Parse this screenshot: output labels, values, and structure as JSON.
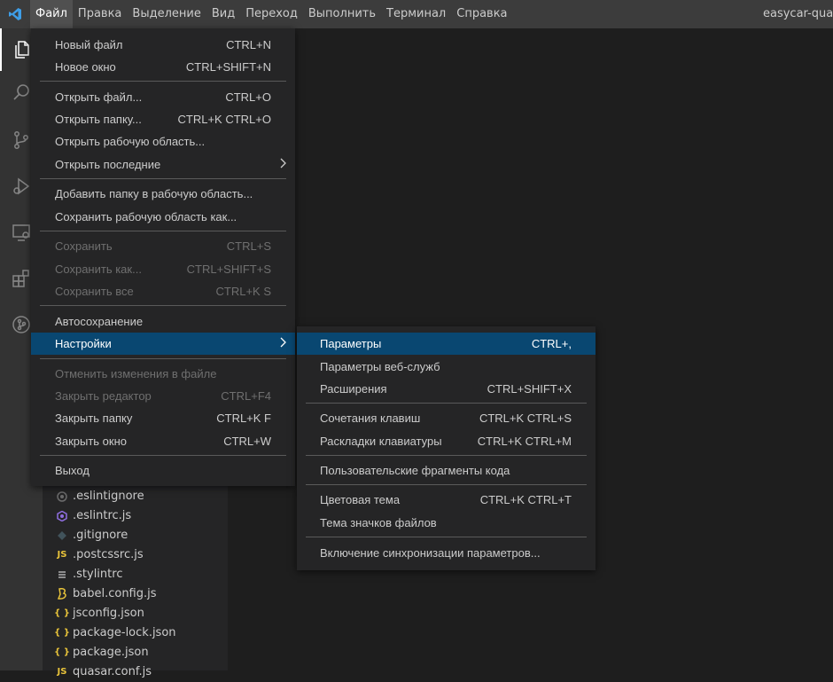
{
  "menubar": {
    "items": [
      "Файл",
      "Правка",
      "Выделение",
      "Вид",
      "Переход",
      "Выполнить",
      "Терминал",
      "Справка"
    ],
    "window_title": "easycar-quasar"
  },
  "colors": {
    "menu_bg": "#252526",
    "selection": "#094771",
    "titlebar": "#3c3c3c",
    "activitybar": "#333333",
    "sidebar": "#252526",
    "editor": "#1e1e1e"
  },
  "activity_icons": [
    "explorer-icon",
    "search-icon",
    "source-control-icon",
    "run-debug-icon",
    "remote-explorer-icon",
    "extensions-icon",
    "git-graph-icon"
  ],
  "file_menu": {
    "items": [
      {
        "label": "Новый файл",
        "shortcut": "CTRL+N"
      },
      {
        "label": "Новое окно",
        "shortcut": "CTRL+SHIFT+N"
      },
      {
        "label": "Открыть файл...",
        "shortcut": "CTRL+O"
      },
      {
        "label": "Открыть папку...",
        "shortcut": "CTRL+K CTRL+O"
      },
      {
        "label": "Открыть рабочую область...",
        "shortcut": ""
      },
      {
        "label": "Открыть последние",
        "shortcut": "",
        "submenu": true
      },
      {
        "label": "Добавить папку в рабочую область...",
        "shortcut": ""
      },
      {
        "label": "Сохранить рабочую область как...",
        "shortcut": ""
      },
      {
        "label": "Сохранить",
        "shortcut": "CTRL+S",
        "disabled": true
      },
      {
        "label": "Сохранить как...",
        "shortcut": "CTRL+SHIFT+S",
        "disabled": true
      },
      {
        "label": "Сохранить все",
        "shortcut": "CTRL+K S",
        "disabled": true
      },
      {
        "label": "Автосохранение",
        "shortcut": ""
      },
      {
        "label": "Настройки",
        "shortcut": "",
        "submenu": true,
        "selected": true
      },
      {
        "label": "Отменить изменения в файле",
        "shortcut": "",
        "disabled": true
      },
      {
        "label": "Закрыть редактор",
        "shortcut": "CTRL+F4",
        "disabled": true
      },
      {
        "label": "Закрыть папку",
        "shortcut": "CTRL+K F"
      },
      {
        "label": "Закрыть окно",
        "shortcut": "CTRL+W"
      },
      {
        "label": "Выход",
        "shortcut": ""
      }
    ]
  },
  "prefs_menu": {
    "items": [
      {
        "label": "Параметры",
        "shortcut": "CTRL+,",
        "selected": true
      },
      {
        "label": "Параметры веб-служб",
        "shortcut": ""
      },
      {
        "label": "Расширения",
        "shortcut": "CTRL+SHIFT+X"
      },
      {
        "label": "Сочетания клавиш",
        "shortcut": "CTRL+K CTRL+S"
      },
      {
        "label": "Раскладки клавиатуры",
        "shortcut": "CTRL+K CTRL+M"
      },
      {
        "label": "Пользовательские фрагменты кода",
        "shortcut": ""
      },
      {
        "label": "Цветовая тема",
        "shortcut": "CTRL+K CTRL+T"
      },
      {
        "label": "Тема значков файлов",
        "shortcut": ""
      },
      {
        "label": "Включение синхронизации параметров...",
        "shortcut": ""
      }
    ]
  },
  "explorer": {
    "files": [
      {
        "name": ".eslintignore",
        "icon": "eslint-ignore-icon"
      },
      {
        "name": ".eslintrc.js",
        "icon": "eslint-icon"
      },
      {
        "name": ".gitignore",
        "icon": "git-icon"
      },
      {
        "name": ".postcssrc.js",
        "icon": "js-icon",
        "icon_text": "JS"
      },
      {
        "name": ".stylintrc",
        "icon": "list-icon"
      },
      {
        "name": "babel.config.js",
        "icon": "babel-icon"
      },
      {
        "name": "jsconfig.json",
        "icon": "json-icon",
        "icon_text": "{ }"
      },
      {
        "name": "package-lock.json",
        "icon": "json-icon",
        "icon_text": "{ }"
      },
      {
        "name": "package.json",
        "icon": "json-icon",
        "icon_text": "{ }"
      },
      {
        "name": "quasar.conf.js",
        "icon": "js-icon",
        "icon_text": "JS"
      }
    ]
  }
}
